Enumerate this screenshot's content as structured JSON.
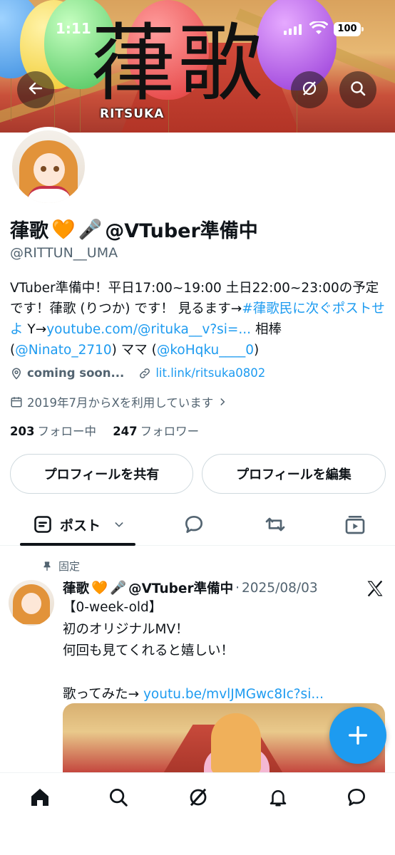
{
  "status_bar": {
    "time": "1:11",
    "battery": "100"
  },
  "banner": {
    "logo_kanji": "葎歌",
    "logo_sub": "RITSUKA"
  },
  "header": {
    "back_icon": "arrow-left-icon",
    "grok_icon": "grok-icon",
    "search_icon": "search-icon"
  },
  "profile": {
    "name": "葎歌",
    "name_suffix": "@VTuber準備中",
    "emoji_heart": "🧡",
    "emoji_mic": "🎤",
    "handle": "@RITTUN__UMA",
    "bio": {
      "text1": "VTuber準備中！平日17:00~19:00 土日22:00~23:00の予定です！葎歌 (りつか) です！ 見るます→",
      "hashtag": "#葎歌民に次ぐポストせよ",
      "text2": " Y→",
      "link1": "youtube.com/@rituka__v?si=...",
      "text3": " 相棒 (",
      "mention1": "@Ninato_2710",
      "text4": ") ママ (",
      "mention2": "@koHqku____0",
      "text5": ")"
    },
    "location": "coming soon...",
    "website": "lit.link/ritsuka0802",
    "joined": "2019年7月からXを利用しています",
    "following_count": "203",
    "following_label": "フォロー中",
    "followers_count": "247",
    "followers_label": "フォロワー",
    "share_button": "プロフィールを共有",
    "edit_button": "プロフィールを編集"
  },
  "tabs": {
    "posts_label": "ポスト"
  },
  "pinned_post": {
    "pinned_label": "固定",
    "author_name": "葎歌",
    "author_suffix": "@VTuber準備中",
    "separator": "·",
    "date": "2025/08/03",
    "line1": "【0-week-old】",
    "line2": "初のオリジナルMV！",
    "line3": "何回も見てくれると嬉しい！",
    "line4_text": "歌ってみた→ ",
    "line4_link": "youtu.be/mvlJMGwc8Ic?si..."
  },
  "fab": {
    "label": "+"
  },
  "colors": {
    "link": "#1d9bf0",
    "muted": "#536471",
    "text": "#0f1419",
    "fab": "#1d9bf0"
  }
}
